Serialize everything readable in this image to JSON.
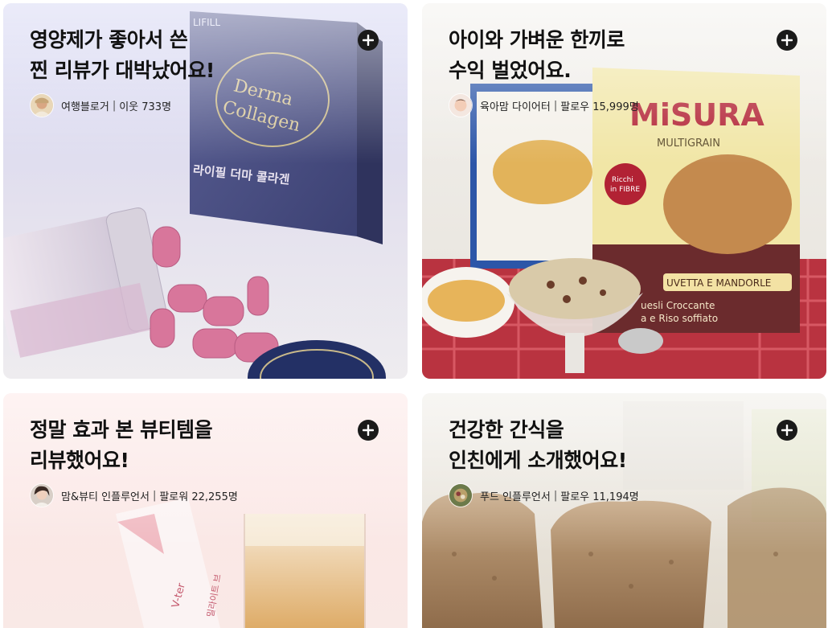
{
  "cards": [
    {
      "title": "영양제가 좋아서 쓴\n찐 리뷰가 대박났어요!",
      "author_name": "여행블로거",
      "author_stat": "이웃 733명",
      "add_icon": "plus-circle-icon",
      "theme_color": "#cfd1ef"
    },
    {
      "title": "아이와 가벼운 한끼로\n수익 벌었어요.",
      "author_name": "육아맘 다이어터",
      "author_stat": "팔로우 15,999명",
      "add_icon": "plus-circle-icon",
      "theme_color": "#f0e7d6"
    },
    {
      "title": "정말 효과 본 뷰티템을\n리뷰했어요!",
      "author_name": "맘&뷰티 인플루언서",
      "author_stat": "팔로워 22,255명",
      "add_icon": "plus-circle-icon",
      "theme_color": "#fbe1e1"
    },
    {
      "title": "건강한 간식을\n인친에게 소개했어요!",
      "author_name": "푸드 인플루언서",
      "author_stat": "팔로우 11,194명",
      "add_icon": "plus-circle-icon",
      "theme_color": "#ece8e0"
    }
  ],
  "product_text": {
    "c1_brand": "LIFILL",
    "c1_box_title": "Derma Collagen",
    "c1_box_korean": "라이필 더마 콜라겐",
    "c2_brand": "MISURA",
    "c2_sub": "MULTIGRAIN",
    "c2_badge": "Ricchi in FIBRE",
    "c2_flavor": "UVETTA E MANDORLE",
    "c2_desc": "uesli Croccante\na e Riso soffiato",
    "c3_brand": "V-ter",
    "c3_korean": "밀라이트 브"
  }
}
